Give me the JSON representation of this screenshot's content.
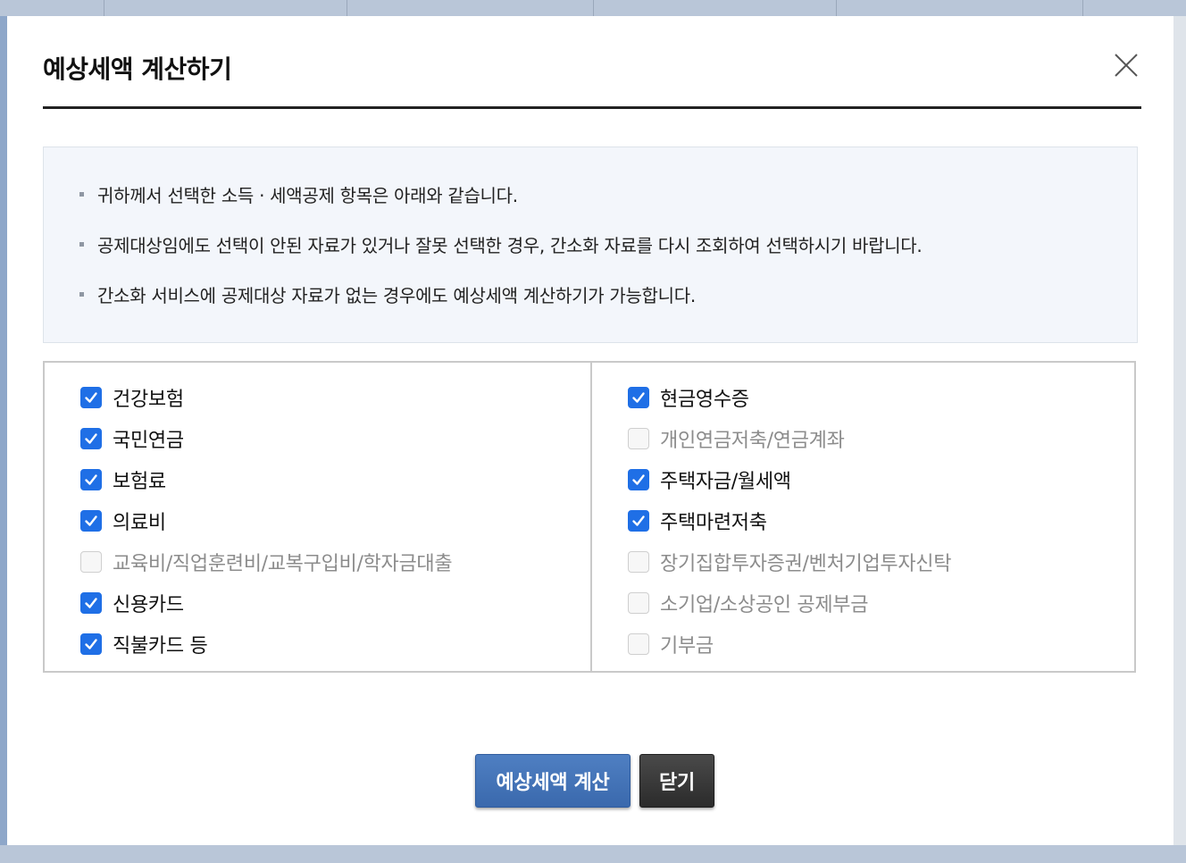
{
  "modal": {
    "title": "예상세액 계산하기"
  },
  "info": {
    "items": [
      "귀하께서 선택한 소득 · 세액공제 항목은 아래와 같습니다.",
      "공제대상임에도 선택이 안된 자료가 있거나 잘못 선택한 경우, 간소화 자료를 다시 조회하여 선택하시기 바랍니다.",
      "간소화 서비스에 공제대상 자료가 없는 경우에도 예상세액 계산하기가 가능합니다."
    ]
  },
  "checks": {
    "left": [
      {
        "label": "건강보험",
        "checked": true
      },
      {
        "label": "국민연금",
        "checked": true
      },
      {
        "label": "보험료",
        "checked": true
      },
      {
        "label": "의료비",
        "checked": true
      },
      {
        "label": "교육비/직업훈련비/교복구입비/학자금대출",
        "checked": false
      },
      {
        "label": "신용카드",
        "checked": true
      },
      {
        "label": "직불카드 등",
        "checked": true
      }
    ],
    "right": [
      {
        "label": "현금영수증",
        "checked": true
      },
      {
        "label": "개인연금저축/연금계좌",
        "checked": false
      },
      {
        "label": "주택자금/월세액",
        "checked": true
      },
      {
        "label": "주택마련저축",
        "checked": true
      },
      {
        "label": "장기집합투자증권/벤처기업투자신탁",
        "checked": false
      },
      {
        "label": "소기업/소상공인 공제부금",
        "checked": false
      },
      {
        "label": "기부금",
        "checked": false
      }
    ]
  },
  "buttons": {
    "calculate": "예상세액 계산",
    "close": "닫기"
  },
  "colors": {
    "checked": "#1f6fe6",
    "calc_button": "#3a69ad",
    "close_button": "#2b2b2b"
  }
}
